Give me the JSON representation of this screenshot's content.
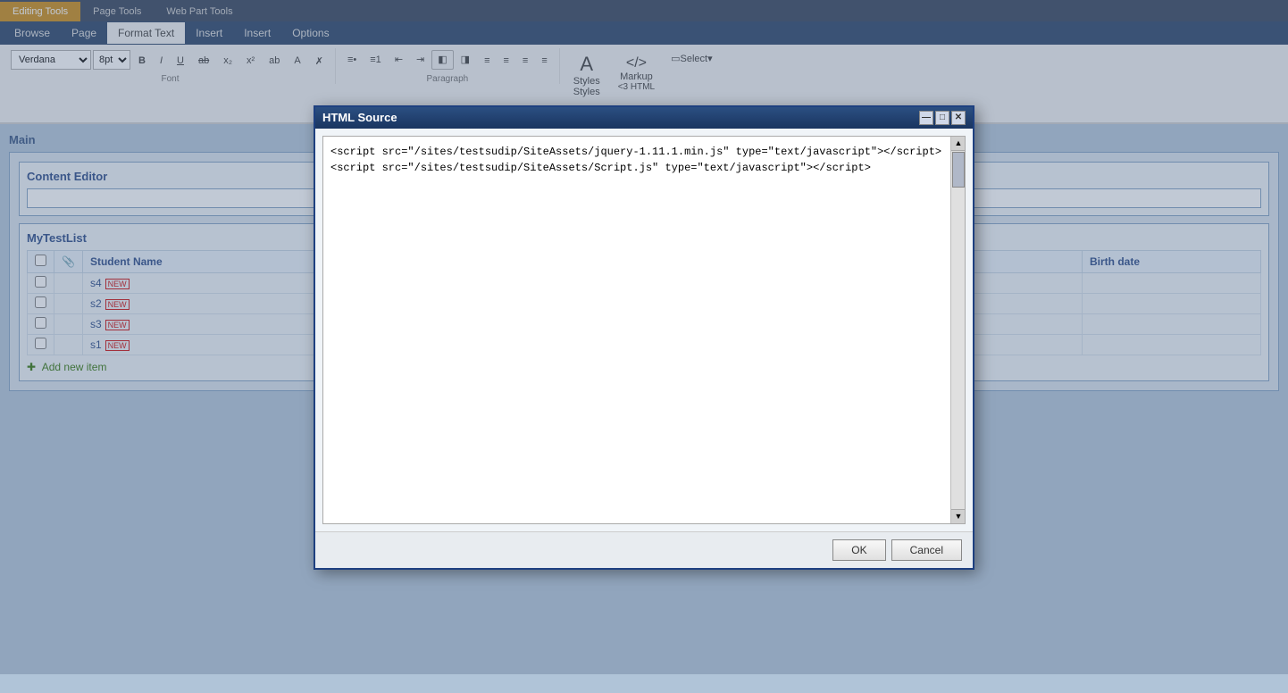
{
  "ribbon": {
    "editing_tools_label": "Editing Tools",
    "tabs": [
      {
        "id": "editing-tools",
        "label": "Editing Tools",
        "active": false,
        "highlight": true
      },
      {
        "id": "page-tools",
        "label": "Page Tools",
        "active": false,
        "highlight": false
      },
      {
        "id": "web-part-tools",
        "label": "Web Part Tools",
        "active": false,
        "highlight": false
      }
    ],
    "nav_tabs": [
      {
        "id": "browse",
        "label": "Browse",
        "active": false
      },
      {
        "id": "page",
        "label": "Page",
        "active": false
      },
      {
        "id": "format-text",
        "label": "Format Text",
        "active": true
      },
      {
        "id": "insert",
        "label": "Insert",
        "active": false
      },
      {
        "id": "insert2",
        "label": "Insert",
        "active": false
      },
      {
        "id": "options",
        "label": "Options",
        "active": false
      }
    ],
    "font": {
      "family": "Verdana",
      "size": "8pt"
    },
    "styles_label": "Styles",
    "markup_label": "Markup",
    "font_section_label": "Font",
    "paragraph_section_label": "Paragraph",
    "styles_section_label": "Styles"
  },
  "page": {
    "main_label": "Main",
    "content_editor_label": "Content Editor",
    "list_title": "MyTestList",
    "columns": {
      "checkbox": "",
      "attach": "📎",
      "student_name": "Student Name",
      "birth_date": "Birth date"
    },
    "rows": [
      {
        "id": "s4",
        "name": "s4",
        "is_new": true
      },
      {
        "id": "s2",
        "name": "s2",
        "is_new": true
      },
      {
        "id": "s3",
        "name": "s3",
        "is_new": true
      },
      {
        "id": "s1",
        "name": "s1",
        "is_new": true
      }
    ],
    "add_new_label": "Add new item"
  },
  "dialog": {
    "title": "HTML Source",
    "content": "<script src=\"/sites/testsudip/SiteAssets/jquery-1.11.1.min.js\" type=\"text/javascript\"></script>\n<script src=\"/sites/testsudip/SiteAssets/Script.js\" type=\"text/javascript\"></script>",
    "ok_label": "OK",
    "cancel_label": "Cancel"
  }
}
